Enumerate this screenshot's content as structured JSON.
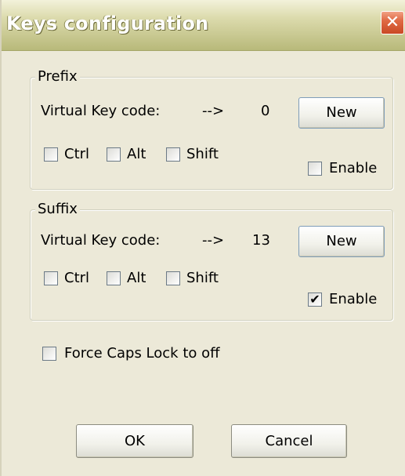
{
  "window": {
    "title": "Keys configuration",
    "close_glyph": "✕"
  },
  "prefix": {
    "group_label": "Prefix",
    "vk_label": "Virtual Key code:",
    "arrow": "-->",
    "vk_value": "0",
    "new_label": "New",
    "ctrl_label": "Ctrl",
    "alt_label": "Alt",
    "shift_label": "Shift",
    "enable_label": "Enable",
    "ctrl_checked": false,
    "alt_checked": false,
    "shift_checked": false,
    "enable_checked": false
  },
  "suffix": {
    "group_label": "Suffix",
    "vk_label": "Virtual Key code:",
    "arrow": "-->",
    "vk_value": "13",
    "new_label": "New",
    "ctrl_label": "Ctrl",
    "alt_label": "Alt",
    "shift_label": "Shift",
    "enable_label": "Enable",
    "ctrl_checked": false,
    "alt_checked": false,
    "shift_checked": false,
    "enable_checked": true
  },
  "options": {
    "force_caps_label": "Force Caps Lock to off",
    "force_caps_checked": false
  },
  "buttons": {
    "ok_label": "OK",
    "cancel_label": "Cancel"
  },
  "check_glyph": "✔"
}
